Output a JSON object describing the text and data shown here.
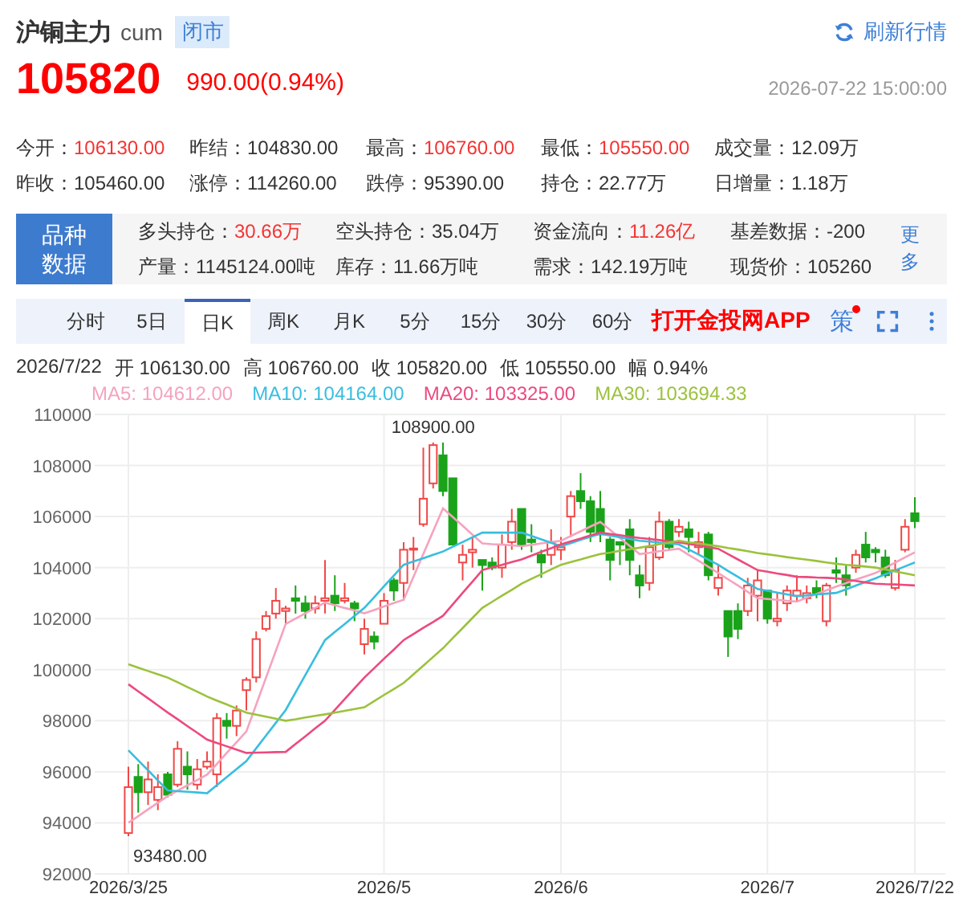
{
  "header": {
    "name": "沪铜主力",
    "code": "cum",
    "status": "闭市",
    "refresh": "刷新行情"
  },
  "quote": {
    "price": "105820",
    "change": "990.00(0.94%)",
    "time": "2026-07-22 15:00:00"
  },
  "stats": [
    {
      "label": "今开：",
      "value": "106130.00",
      "highlight": true
    },
    {
      "label": "昨结：",
      "value": "104830.00",
      "highlight": false
    },
    {
      "label": "最高：",
      "value": "106760.00",
      "highlight": true
    },
    {
      "label": "最低：",
      "value": "105550.00",
      "highlight": true
    },
    {
      "label": "成交量：",
      "value": "12.09万",
      "highlight": false
    },
    {
      "label": "昨收：",
      "value": "105460.00",
      "highlight": false
    },
    {
      "label": "涨停：",
      "value": "114260.00",
      "highlight": false
    },
    {
      "label": "跌停：",
      "value": "95390.00",
      "highlight": false
    },
    {
      "label": "持仓：",
      "value": "22.77万",
      "highlight": false
    },
    {
      "label": "日增量：",
      "value": "1.18万",
      "highlight": false
    }
  ],
  "variety": {
    "button": "品种数据",
    "more": "更多",
    "items": [
      {
        "label": "多头持仓：",
        "value": "30.66万",
        "highlight": true
      },
      {
        "label": "空头持仓：",
        "value": "35.04万",
        "highlight": false
      },
      {
        "label": "资金流向：",
        "value": "11.26亿",
        "highlight": true
      },
      {
        "label": "基差数据：",
        "value": "-200",
        "highlight": false
      },
      {
        "label": "产量：",
        "value": "1145124.00吨",
        "highlight": false
      },
      {
        "label": "库存：",
        "value": "11.66万吨",
        "highlight": false
      },
      {
        "label": "需求：",
        "value": "142.19万吨",
        "highlight": false
      },
      {
        "label": "现货价：",
        "value": "105260",
        "highlight": false
      }
    ]
  },
  "tabs": [
    {
      "label": "分时",
      "selected": false
    },
    {
      "label": "5日",
      "selected": false
    },
    {
      "label": "日K",
      "selected": true
    },
    {
      "label": "周K",
      "selected": false
    },
    {
      "label": "月K",
      "selected": false
    },
    {
      "label": "5分",
      "selected": false
    },
    {
      "label": "15分",
      "selected": false
    },
    {
      "label": "30分",
      "selected": false
    },
    {
      "label": "60分",
      "selected": false
    }
  ],
  "app_link": "打开金投网APP",
  "strategy": {
    "label": "策",
    "badge": true
  },
  "ohlc": {
    "date": "2026/7/22",
    "items": [
      {
        "label": "开",
        "value": "106130.00"
      },
      {
        "label": "高",
        "value": "106760.00"
      },
      {
        "label": "收",
        "value": "105820.00"
      },
      {
        "label": "低",
        "value": "105550.00"
      },
      {
        "label": "幅",
        "value": "0.94%"
      }
    ]
  },
  "ma_legend": [
    {
      "value": ": 104612.00"
    },
    {
      "value": ": 104164.00"
    },
    {
      "value": ": 103325.00"
    },
    {
      "value": ": 103694.33"
    }
  ],
  "extremes": {
    "high": "108900.00",
    "low": "93480.00"
  },
  "chart_data": {
    "type": "candlestick",
    "grid": true,
    "ylim": [
      92000,
      110000
    ],
    "yticks": [
      92000,
      94000,
      96000,
      98000,
      100000,
      102000,
      104000,
      106000,
      108000,
      110000
    ],
    "categories": [
      "2026/3/25",
      null,
      null,
      null,
      null,
      null,
      null,
      null,
      null,
      null,
      null,
      null,
      null,
      null,
      null,
      null,
      null,
      null,
      null,
      null,
      null,
      null,
      null,
      null,
      null,
      null,
      "2026/5",
      null,
      null,
      null,
      null,
      null,
      null,
      null,
      null,
      null,
      null,
      null,
      null,
      null,
      null,
      null,
      null,
      null,
      "2026/6",
      null,
      null,
      null,
      null,
      null,
      null,
      null,
      null,
      null,
      null,
      null,
      null,
      null,
      null,
      null,
      null,
      null,
      null,
      null,
      null,
      "2026/7",
      null,
      null,
      null,
      null,
      null,
      null,
      null,
      null,
      null,
      null,
      null,
      null,
      null,
      null,
      "2026/7/22"
    ],
    "ohlc": [
      [
        93600,
        96200,
        93480,
        95400
      ],
      [
        95800,
        96300,
        94400,
        95200
      ],
      [
        95200,
        96400,
        94700,
        95700
      ],
      [
        94900,
        95900,
        94500,
        95400
      ],
      [
        95900,
        96000,
        95000,
        95100
      ],
      [
        95500,
        97200,
        95400,
        96900
      ],
      [
        96200,
        96800,
        95300,
        95900
      ],
      [
        95500,
        96500,
        95300,
        96100
      ],
      [
        96200,
        96800,
        96100,
        96400
      ],
      [
        95900,
        98300,
        95400,
        98100
      ],
      [
        98000,
        98300,
        97300,
        97800
      ],
      [
        97800,
        98600,
        97400,
        98400
      ],
      [
        99200,
        99700,
        98400,
        99600
      ],
      [
        99700,
        101500,
        99500,
        101200
      ],
      [
        101600,
        102300,
        101500,
        102100
      ],
      [
        102200,
        103200,
        102000,
        102700
      ],
      [
        102300,
        102500,
        101800,
        102400
      ],
      [
        102800,
        103300,
        102200,
        102700
      ],
      [
        102600,
        102900,
        102000,
        102300
      ],
      [
        102400,
        102900,
        102200,
        102600
      ],
      [
        102700,
        104300,
        102200,
        102800
      ],
      [
        102900,
        103700,
        102300,
        102600
      ],
      [
        102700,
        103400,
        102600,
        102800
      ],
      [
        102600,
        102700,
        101900,
        102400
      ],
      [
        101000,
        102000,
        100600,
        101600
      ],
      [
        101300,
        101500,
        100800,
        101100
      ],
      [
        101800,
        103000,
        101800,
        102700
      ],
      [
        103500,
        103600,
        102700,
        103100
      ],
      [
        103400,
        105000,
        102700,
        104700
      ],
      [
        104700,
        105200,
        103900,
        104750
      ],
      [
        105700,
        108700,
        105600,
        106700
      ],
      [
        107300,
        108900,
        107100,
        108800
      ],
      [
        108400,
        108900,
        106800,
        107000
      ],
      [
        107500,
        107500,
        104900,
        104900
      ],
      [
        104200,
        104900,
        103500,
        104500
      ],
      [
        104600,
        105200,
        104000,
        104700
      ],
      [
        104300,
        104300,
        103100,
        104100
      ],
      [
        104200,
        104400,
        103900,
        104000
      ],
      [
        104000,
        105300,
        103600,
        104900
      ],
      [
        105000,
        106300,
        104700,
        105800
      ],
      [
        106300,
        106300,
        104700,
        104900
      ],
      [
        105100,
        105700,
        104600,
        105000
      ],
      [
        104500,
        104700,
        103600,
        104200
      ],
      [
        104500,
        105500,
        104100,
        105000
      ],
      [
        104700,
        105200,
        104300,
        104800
      ],
      [
        106000,
        107000,
        105200,
        106800
      ],
      [
        107000,
        107700,
        106300,
        106600
      ],
      [
        106600,
        106800,
        105000,
        105400
      ],
      [
        106300,
        107000,
        105000,
        105300
      ],
      [
        105100,
        105200,
        103500,
        104300
      ],
      [
        105000,
        105000,
        104100,
        104900
      ],
      [
        105500,
        105900,
        103700,
        104300
      ],
      [
        103700,
        104100,
        102800,
        103300
      ],
      [
        103400,
        105200,
        103100,
        104800
      ],
      [
        104400,
        106200,
        104300,
        105800
      ],
      [
        105800,
        105900,
        104700,
        104800
      ],
      [
        105400,
        105900,
        105200,
        105600
      ],
      [
        105500,
        105800,
        104600,
        105200
      ],
      [
        104800,
        105400,
        104500,
        105000
      ],
      [
        105300,
        105400,
        103500,
        103700
      ],
      [
        103200,
        104100,
        102900,
        103600
      ],
      [
        102300,
        102300,
        100500,
        101300
      ],
      [
        102300,
        102600,
        101200,
        101600
      ],
      [
        102300,
        103600,
        102100,
        103300
      ],
      [
        102900,
        103900,
        101900,
        103500
      ],
      [
        103100,
        103100,
        101800,
        102000
      ],
      [
        101900,
        103000,
        101700,
        102000
      ],
      [
        102600,
        103300,
        102300,
        103100
      ],
      [
        102900,
        103700,
        102700,
        103100
      ],
      [
        102800,
        103300,
        102600,
        103000
      ],
      [
        103200,
        103500,
        102800,
        103000
      ],
      [
        101900,
        103400,
        101700,
        103300
      ],
      [
        103900,
        104400,
        103400,
        103800
      ],
      [
        103700,
        104100,
        102900,
        103300
      ],
      [
        104000,
        104700,
        103800,
        104500
      ],
      [
        104900,
        105400,
        104200,
        104400
      ],
      [
        104700,
        104800,
        104200,
        104600
      ],
      [
        104400,
        104700,
        103600,
        103700
      ],
      [
        103200,
        104300,
        103100,
        103900
      ],
      [
        104700,
        105900,
        104600,
        105600
      ],
      [
        106130,
        106760,
        105550,
        105820
      ]
    ],
    "series": [
      {
        "name": "MA5",
        "type": "line",
        "color": "#f5a3be",
        "values": [
          94000,
          94260,
          94530,
          94790,
          95050,
          95260,
          95470,
          95680,
          95890,
          96310,
          96740,
          97160,
          97580,
          98630,
          99690,
          100740,
          101790,
          102000,
          102210,
          102420,
          102630,
          102530,
          102420,
          102320,
          102210,
          102340,
          102480,
          102610,
          102740,
          103640,
          104530,
          105430,
          106320,
          105980,
          105640,
          105290,
          104950,
          104920,
          104900,
          104870,
          104840,
          104890,
          104950,
          105000,
          105050,
          105240,
          105420,
          105610,
          105790,
          105480,
          105160,
          104850,
          104530,
          104580,
          104640,
          104690,
          104740,
          104500,
          104270,
          104030,
          103790,
          103540,
          103300,
          103050,
          102800,
          102770,
          102740,
          102700,
          102670,
          102820,
          102970,
          103110,
          103260,
          103390,
          103530,
          103660,
          103790,
          103990,
          104200,
          104400,
          104600
        ]
      },
      {
        "name": "MA10",
        "type": "line",
        "color": "#38bede",
        "values": [
          96840,
          96450,
          96060,
          95660,
          95270,
          95240,
          95220,
          95190,
          95160,
          95480,
          95790,
          96110,
          96420,
          96920,
          97420,
          97920,
          98420,
          99110,
          99790,
          100480,
          101160,
          101480,
          101790,
          102110,
          102420,
          102840,
          103270,
          103690,
          104110,
          104240,
          104370,
          104500,
          104630,
          104820,
          105000,
          105190,
          105370,
          105370,
          105370,
          105370,
          105370,
          105240,
          105110,
          104970,
          104840,
          104960,
          105090,
          105210,
          105330,
          105260,
          105190,
          105120,
          105050,
          105020,
          104980,
          104950,
          104910,
          104710,
          104510,
          104310,
          104110,
          103870,
          103640,
          103400,
          103160,
          103090,
          103020,
          102950,
          102880,
          102910,
          102950,
          102980,
          103010,
          103150,
          103300,
          103440,
          103580,
          103740,
          103890,
          104050,
          104200
        ]
      },
      {
        "name": "MA20",
        "type": "line",
        "color": "#ec4a7d",
        "values": [
          99430,
          99150,
          98880,
          98600,
          98320,
          98060,
          97790,
          97530,
          97260,
          97130,
          97000,
          96870,
          96740,
          96750,
          96760,
          96770,
          96780,
          97090,
          97390,
          97700,
          98000,
          98420,
          98850,
          99270,
          99690,
          100060,
          100430,
          100790,
          101160,
          101400,
          101640,
          101870,
          102110,
          102560,
          103010,
          103450,
          103900,
          104010,
          104110,
          104220,
          104320,
          104470,
          104620,
          104760,
          104910,
          105030,
          105140,
          105260,
          105370,
          105320,
          105270,
          105210,
          105160,
          105120,
          105080,
          105030,
          104990,
          104930,
          104870,
          104800,
          104740,
          104530,
          104320,
          104110,
          103900,
          103840,
          103770,
          103710,
          103640,
          103630,
          103610,
          103600,
          103580,
          103530,
          103480,
          103420,
          103370,
          103350,
          103340,
          103320,
          103300
        ]
      },
      {
        "name": "MA30",
        "type": "line",
        "color": "#9bc23c",
        "values": [
          100210,
          100080,
          99950,
          99820,
          99690,
          99510,
          99320,
          99140,
          98950,
          98790,
          98640,
          98480,
          98320,
          98240,
          98160,
          98080,
          98000,
          98060,
          98130,
          98190,
          98250,
          98320,
          98390,
          98460,
          98530,
          98770,
          99010,
          99240,
          99480,
          99820,
          100160,
          100500,
          100840,
          101240,
          101630,
          102030,
          102420,
          102660,
          102900,
          103130,
          103370,
          103560,
          103740,
          103930,
          104110,
          104220,
          104320,
          104430,
          104530,
          104590,
          104660,
          104720,
          104780,
          104850,
          104920,
          104980,
          105050,
          104990,
          104950,
          104890,
          104840,
          104770,
          104710,
          104640,
          104570,
          104520,
          104470,
          104410,
          104360,
          104310,
          104260,
          104200,
          104150,
          104110,
          104080,
          104040,
          104000,
          103930,
          103850,
          103780,
          103700
        ]
      }
    ]
  }
}
